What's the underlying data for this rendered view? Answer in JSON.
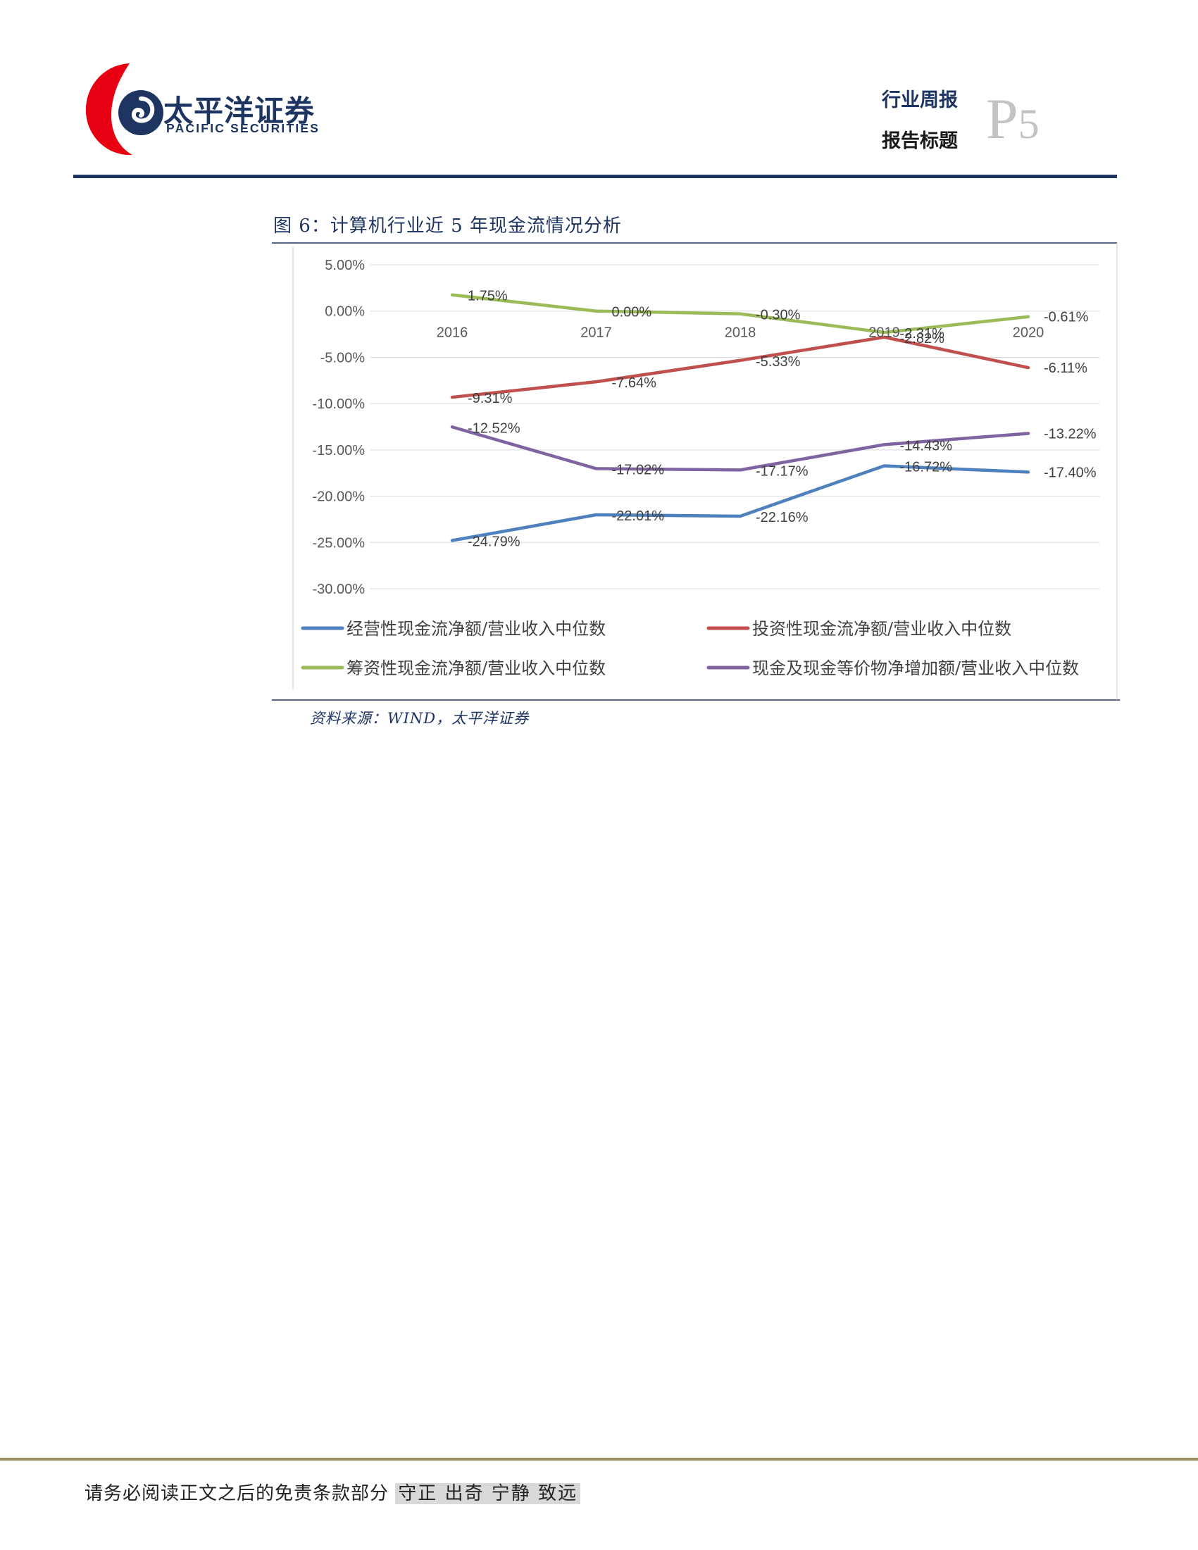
{
  "header": {
    "brand_cn": "太平洋证券",
    "brand_en": "PACIFIC SECURITIES",
    "report_type": "行业周报",
    "report_title": "报告标题",
    "page_letter": "P",
    "page_number": "5",
    "accent_color": "#1e3562",
    "logo_red": "#e60012"
  },
  "figure": {
    "caption": "图 6：计算机行业近 5 年现金流情况分析",
    "source": "资料来源：WIND，太平洋证券"
  },
  "chart_data": {
    "type": "line",
    "categories": [
      "2016",
      "2017",
      "2018",
      "2019",
      "2020"
    ],
    "y_ticks": [
      "5.00%",
      "0.00%",
      "-5.00%",
      "-10.00%",
      "-15.00%",
      "-20.00%",
      "-25.00%",
      "-30.00%"
    ],
    "ylim": [
      -30,
      5
    ],
    "grid": true,
    "legend_position": "bottom",
    "series": [
      {
        "name": "经营性现金流净额/营业收入中位数",
        "color": "#4f81bd",
        "values": [
          -24.79,
          -22.01,
          -22.16,
          -16.72,
          -17.4
        ],
        "labels": [
          "-24.79%",
          "-22.01%",
          "-22.16%",
          "-16.72%",
          "-17.40%"
        ]
      },
      {
        "name": "投资性现金流净额/营业收入中位数",
        "color": "#c0504d",
        "values": [
          -9.31,
          -7.64,
          -5.33,
          -2.82,
          -6.11
        ],
        "labels": [
          "-9.31%",
          "-7.64%",
          "-5.33%",
          "-2.82%",
          "-6.11%"
        ]
      },
      {
        "name": "筹资性现金流净额/营业收入中位数",
        "color": "#9bbb59",
        "values": [
          1.75,
          0.0,
          -0.3,
          -2.31,
          -0.61
        ],
        "labels": [
          "1.75%",
          "0.00%",
          "-0.30%",
          "-2.31%",
          "-0.61%"
        ]
      },
      {
        "name": "现金及现金等价物净增加额/营业收入中位数",
        "color": "#8064a2",
        "values": [
          -12.52,
          -17.02,
          -17.17,
          -14.43,
          -13.22
        ],
        "labels": [
          "-12.52%",
          "-17.02%",
          "-17.17%",
          "-14.43%",
          "-13.22%"
        ]
      }
    ]
  },
  "footer": {
    "disclaimer": "请务必阅读正文之后的免责条款部分",
    "motto": "守正 出奇 宁静 致远",
    "rule_color": "#9b8f62"
  }
}
